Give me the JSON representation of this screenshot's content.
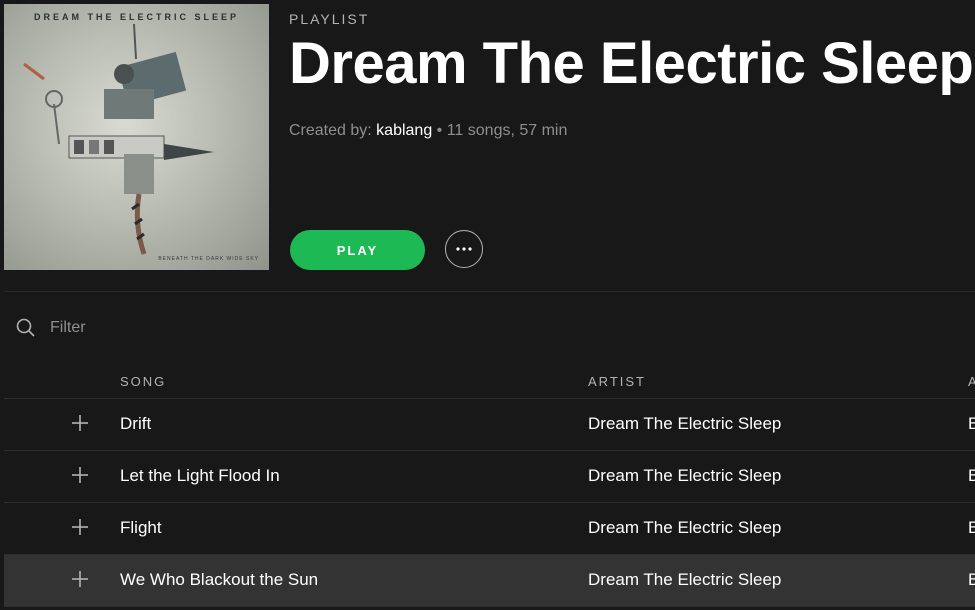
{
  "cover": {
    "band_text": "DREAM THE ELECTRIC SLEEP",
    "album_text": "BENEATH THE DARK WIDE SKY"
  },
  "header": {
    "type_label": "PLAYLIST",
    "title": "Dream The Electric Sleep",
    "created_by_label": "Created by:",
    "owner": "kablang",
    "details": "• 11 songs, 57 min"
  },
  "actions": {
    "play_label": "PLAY",
    "more_label": "···"
  },
  "filter": {
    "placeholder": "Filter"
  },
  "table": {
    "headers": {
      "song": "SONG",
      "artist": "ARTIST",
      "album": "A"
    },
    "rows": [
      {
        "song": "Drift",
        "artist": "Dream The Electric Sleep",
        "album": "B"
      },
      {
        "song": "Let the Light Flood In",
        "artist": "Dream The Electric Sleep",
        "album": "B"
      },
      {
        "song": "Flight",
        "artist": "Dream The Electric Sleep",
        "album": "B"
      },
      {
        "song": "We Who Blackout the Sun",
        "artist": "Dream The Electric Sleep",
        "album": "B"
      }
    ]
  },
  "colors": {
    "background": "#181818",
    "accent": "#1db954",
    "row_highlight": "#333333"
  }
}
